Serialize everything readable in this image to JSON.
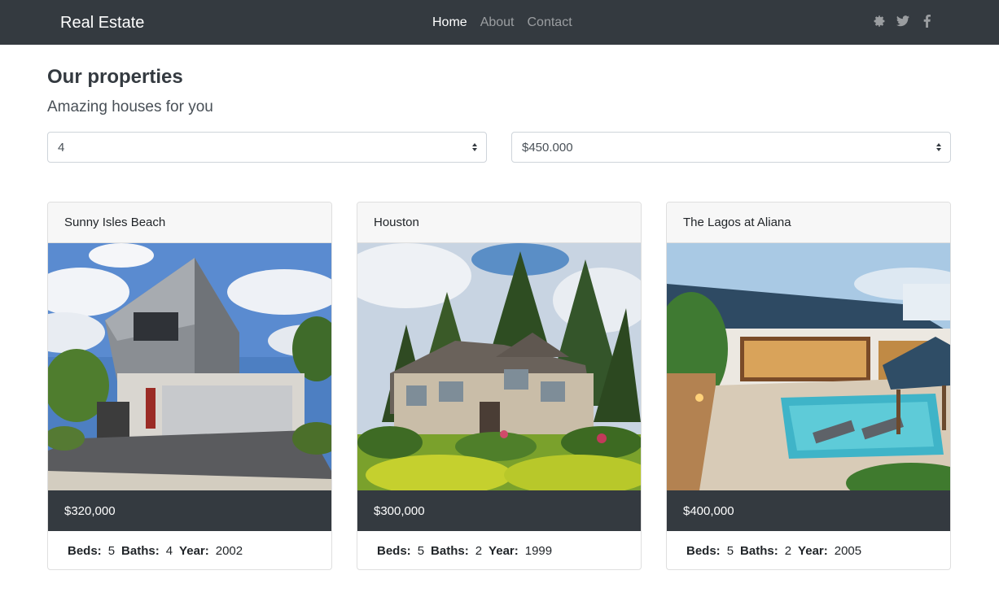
{
  "navbar": {
    "brand": "Real Estate",
    "links": [
      {
        "label": "Home",
        "active": true
      },
      {
        "label": "About",
        "active": false
      },
      {
        "label": "Contact",
        "active": false
      }
    ],
    "social_icons": [
      "gear-icon",
      "twitter-icon",
      "facebook-icon"
    ]
  },
  "header": {
    "title": "Our properties",
    "subtitle": "Amazing houses for you"
  },
  "filters": {
    "beds_selected": "4",
    "price_selected": "$450.000"
  },
  "properties": [
    {
      "name": "Sunny Isles Beach",
      "price": "$320,000",
      "beds": "5",
      "baths": "4",
      "year": "2002",
      "image": "modern-house-photo"
    },
    {
      "name": "Houston",
      "price": "$300,000",
      "beds": "5",
      "baths": "2",
      "year": "1999",
      "image": "suburban-house-photo"
    },
    {
      "name": "The Lagos at Aliana",
      "price": "$400,000",
      "beds": "5",
      "baths": "2",
      "year": "2005",
      "image": "pool-house-photo"
    }
  ],
  "labels": {
    "beds": "Beds:",
    "baths": "Baths:",
    "year": "Year:"
  },
  "colors": {
    "navbar": "#343a40",
    "card_header": "#f7f7f7",
    "price_band": "#343a40"
  }
}
